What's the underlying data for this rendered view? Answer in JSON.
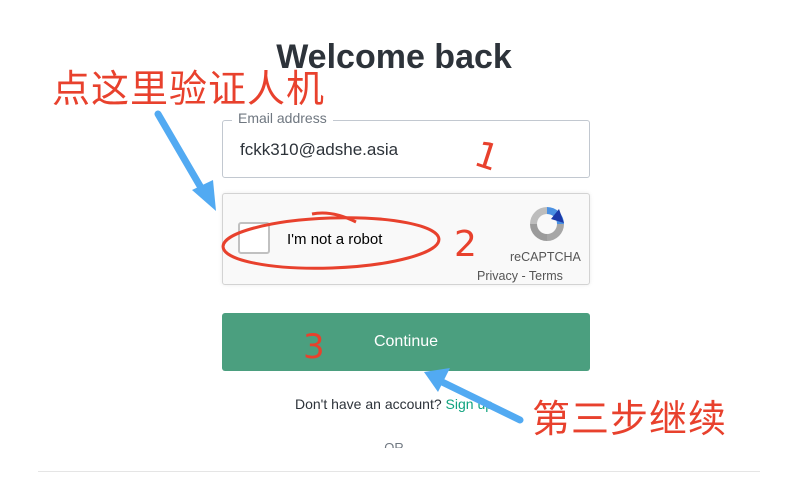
{
  "page": {
    "title": "Welcome back"
  },
  "email": {
    "label": "Email address",
    "value": "fckk310@adshe.asia"
  },
  "captcha": {
    "label": "I'm not a robot",
    "brand": "reCAPTCHA",
    "privacy": "Privacy",
    "separator": " - ",
    "terms": "Terms"
  },
  "continue_button": {
    "label": "Continue"
  },
  "signup": {
    "prompt": "Don't have an account?",
    "link": "Sign up"
  },
  "or_text": "OR",
  "annotations": {
    "top_note": "点这里验证人机",
    "bottom_note": "第三步继续",
    "step1": "1",
    "step2": "2",
    "step3": "3"
  },
  "colors": {
    "continue_bg": "#4b9f7f",
    "link": "#10a37f",
    "annotation_red": "#e8412d",
    "annotation_blue": "#52aaf2"
  }
}
